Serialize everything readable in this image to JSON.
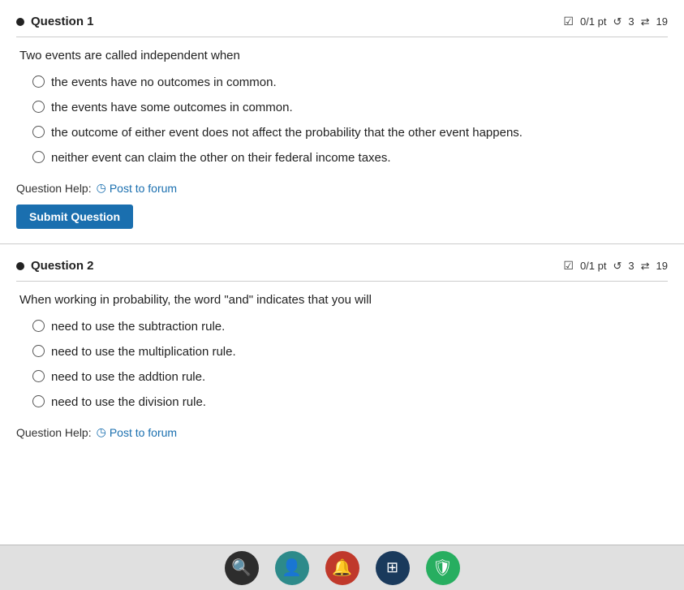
{
  "question1": {
    "title": "Question 1",
    "meta": {
      "score": "0/1 pt",
      "retries": "3",
      "submissions": "19"
    },
    "prompt": "Two events are called independent when",
    "options": [
      "the events have no outcomes in common.",
      "the events have some outcomes in common.",
      "the outcome of either event does not affect the probability that the other event happens.",
      "neither event can claim the other on their federal income taxes."
    ],
    "help_label": "Question Help:",
    "post_to_forum": "Post to forum",
    "submit_label": "Submit Question"
  },
  "question2": {
    "title": "Question 2",
    "meta": {
      "score": "0/1 pt",
      "retries": "3",
      "submissions": "19"
    },
    "prompt": "When working in probability, the word \"and\" indicates that you will",
    "options": [
      "need to use the subtraction rule.",
      "need to use the multiplication rule.",
      "need to use the addtion rule.",
      "need to use the division rule."
    ],
    "help_label": "Question Help:",
    "post_to_forum": "Post to forum"
  },
  "taskbar": {
    "icons": [
      {
        "name": "search",
        "symbol": "🔍",
        "style": "dark"
      },
      {
        "name": "person",
        "symbol": "👤",
        "style": "teal"
      },
      {
        "name": "bell",
        "symbol": "🔔",
        "style": "red"
      },
      {
        "name": "grid",
        "symbol": "⊞",
        "style": "blue-dark"
      },
      {
        "name": "shield",
        "symbol": "🛡",
        "style": "green"
      }
    ]
  }
}
